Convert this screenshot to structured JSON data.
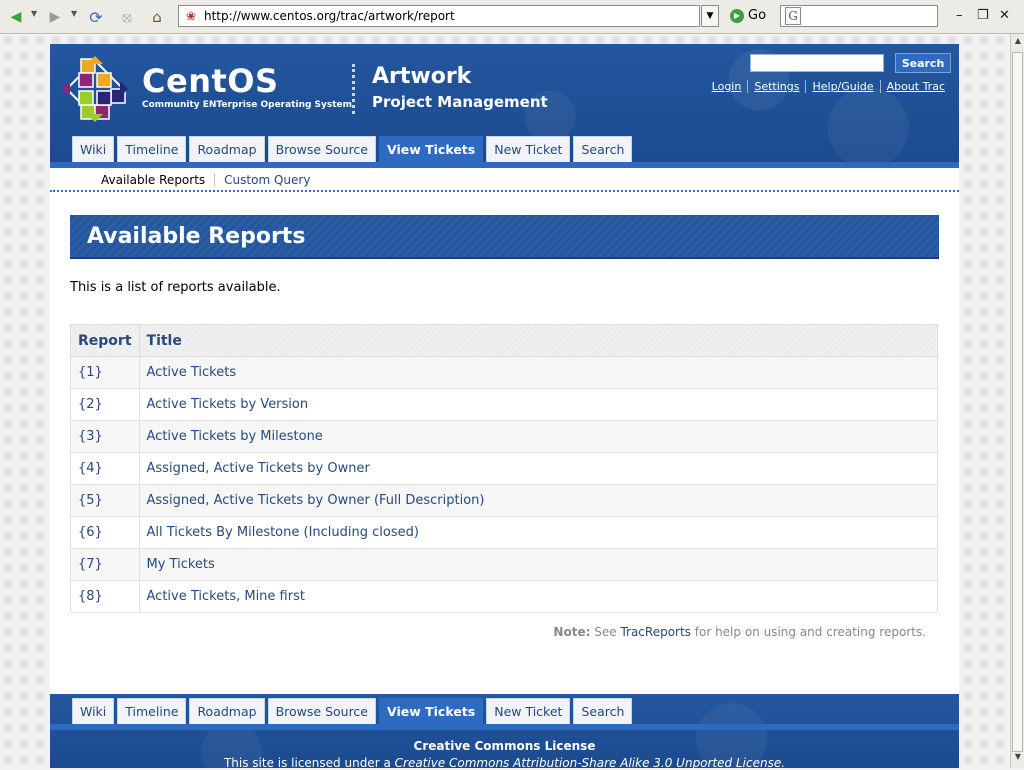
{
  "browser": {
    "url": "http://www.centos.org/trac/artwork/report",
    "go_label": "Go",
    "search_placeholder": ""
  },
  "header": {
    "brand": "CentOS",
    "tagline": "Community ENTerprise Operating System",
    "project_line1": "Artwork",
    "project_line2": "Project Management",
    "search_button": "Search",
    "metanav": [
      "Login",
      "Settings",
      "Help/Guide",
      "About Trac"
    ]
  },
  "mainnav": [
    "Wiki",
    "Timeline",
    "Roadmap",
    "Browse Source",
    "View Tickets",
    "New Ticket",
    "Search"
  ],
  "mainnav_active": "View Tickets",
  "ctxnav": [
    "Available Reports",
    "Custom Query"
  ],
  "content": {
    "title": "Available Reports",
    "intro": "This is a list of reports available.",
    "table_headers": [
      "Report",
      "Title"
    ],
    "rows": [
      {
        "id": "{1}",
        "title": "Active Tickets"
      },
      {
        "id": "{2}",
        "title": "Active Tickets by Version"
      },
      {
        "id": "{3}",
        "title": "Active Tickets by Milestone"
      },
      {
        "id": "{4}",
        "title": "Assigned, Active Tickets by Owner"
      },
      {
        "id": "{5}",
        "title": "Assigned, Active Tickets by Owner (Full Description)"
      },
      {
        "id": "{6}",
        "title": "All Tickets By Milestone (Including closed)"
      },
      {
        "id": "{7}",
        "title": "My Tickets"
      },
      {
        "id": "{8}",
        "title": "Active Tickets, Mine first"
      }
    ],
    "note_label": "Note:",
    "note_pre": "See",
    "note_link": "TracReports",
    "note_post": "for help on using and creating reports."
  },
  "footer": {
    "license_title": "Creative Commons License",
    "license_pre": "This site is licensed under a",
    "license_link": "Creative Commons Attribution-Share Alike 3.0 Unported License."
  },
  "colors": {
    "header_blue": "#1e4d92",
    "tab_active": "#2e6bc0",
    "link": "#26497f"
  }
}
